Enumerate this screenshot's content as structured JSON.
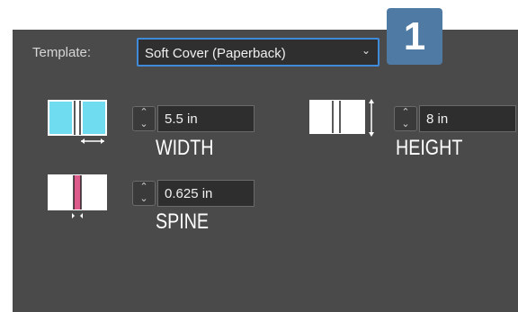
{
  "badge": "1",
  "template": {
    "label": "Template:",
    "value": "Soft Cover (Paperback)"
  },
  "width": {
    "value": "5.5 in",
    "caption": "WIDTH"
  },
  "height": {
    "value": "8 in",
    "caption": "HEIGHT"
  },
  "spine": {
    "value": "0.625 in",
    "caption": "SPINE"
  },
  "colors": {
    "panel": "#4a4a4a",
    "badge": "#4f7aa3",
    "highlight_cyan": "#6fdcf0",
    "highlight_pink": "#dd5c8c",
    "focus_border": "#3f8ad9"
  },
  "icons": [
    "width-book-icon",
    "height-book-icon",
    "spine-book-icon",
    "dropdown-chevron-icon",
    "stepper-up-icon",
    "stepper-down-icon"
  ]
}
